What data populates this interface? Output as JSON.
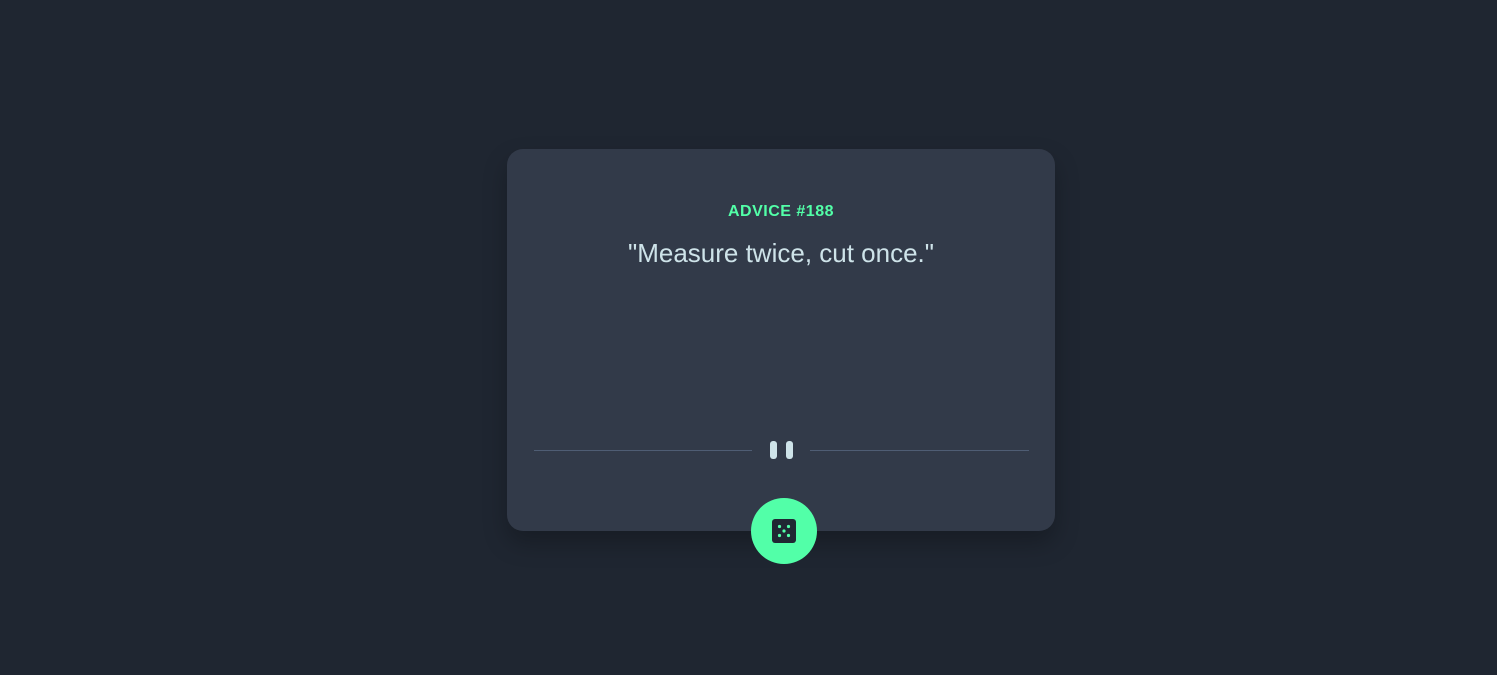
{
  "advice": {
    "id_label": "ADVICE #188",
    "text": "\"Measure twice, cut once.\""
  },
  "divider": {
    "icon": "pause-quote-icon"
  },
  "generate_button": {
    "icon": "dice-icon"
  },
  "colors": {
    "background": "#1f2631",
    "card": "#323a49",
    "accent": "#52ffa8",
    "text": "#cee3e9",
    "divider": "#4f5d74"
  }
}
